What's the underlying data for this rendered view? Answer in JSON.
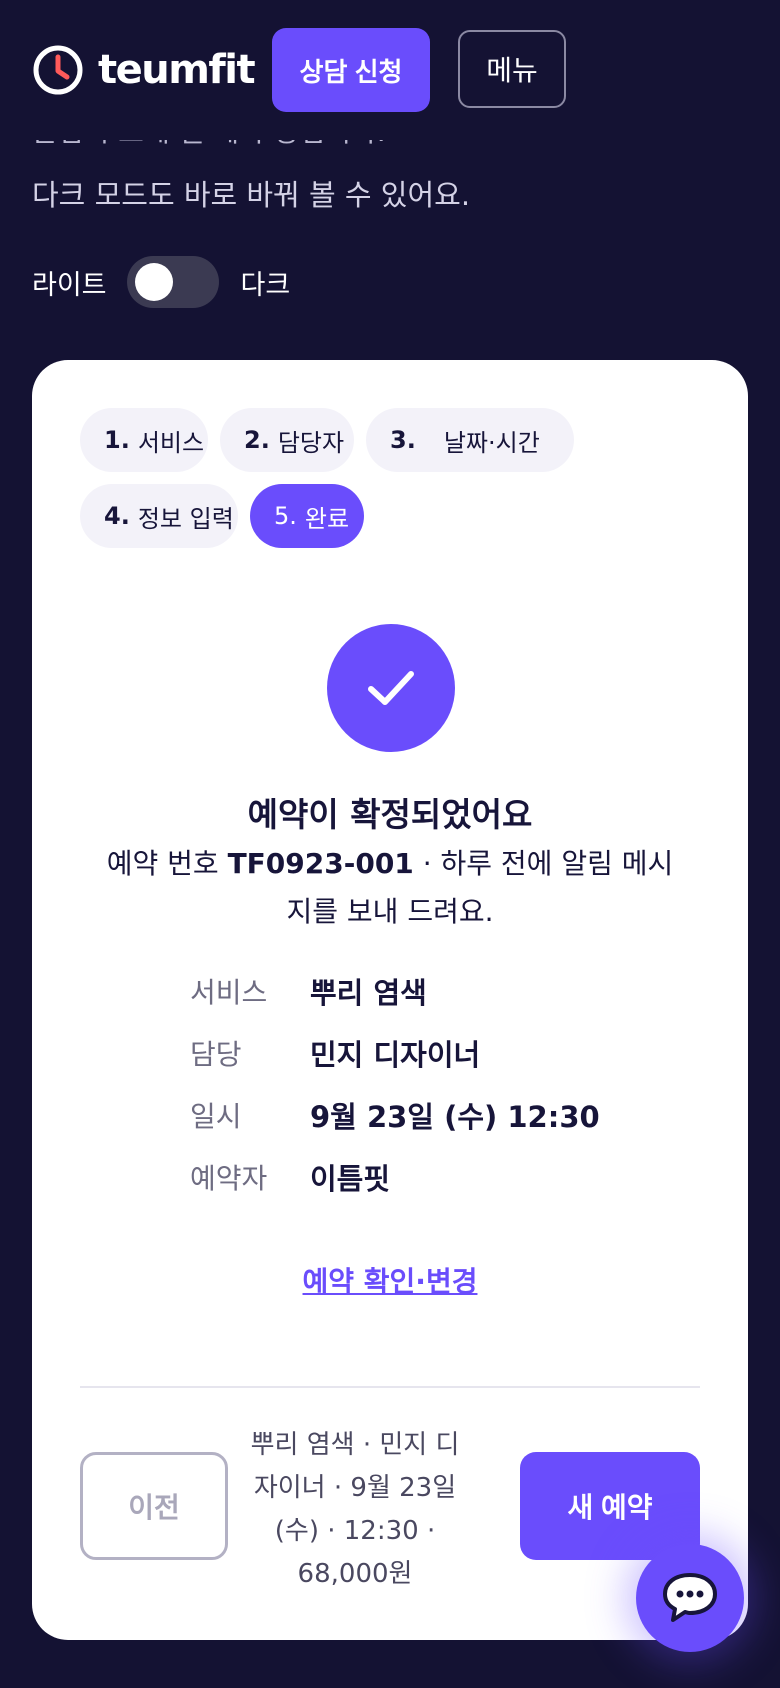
{
  "header": {
    "brand": "teumfit",
    "consult_button": "상담 신청",
    "menu_button": "메뉴"
  },
  "intro": {
    "clipped_line": "손님이 보게 될 예약 장입니다.",
    "line2": "다크 모드도 바로 바꿔 볼 수 있어요."
  },
  "theme": {
    "light_label": "라이트",
    "dark_label": "다크",
    "dark_mode_on": false
  },
  "steps": [
    {
      "num": "1.",
      "label": "서비스"
    },
    {
      "num": "2.",
      "label": "담당자"
    },
    {
      "num": "3.",
      "label": "날짜·시간"
    },
    {
      "num": "4.",
      "label": "정보 입력"
    },
    {
      "num": "5.",
      "label": "완료",
      "active": true
    }
  ],
  "confirmation": {
    "title": "예약이 확정되었어요",
    "desc_prefix": "예약 번호 ",
    "booking_no": "TF0923-001",
    "desc_suffix": " · 하루 전에 알림 메시지를 보내 드려요."
  },
  "details": [
    {
      "key": "서비스",
      "value": "뿌리 염색"
    },
    {
      "key": "담당",
      "value": "민지 디자이너"
    },
    {
      "key": "일시",
      "value": "9월 23일 (수) 12:30"
    },
    {
      "key": "예약자",
      "value": "이틈핏"
    }
  ],
  "manage_link": "예약 확인·변경",
  "footer": {
    "prev_button": "이전",
    "summary": "뿌리 염색 · 민지 디자이너 · 9월 23일 (수) · 12:30 · 68,000원",
    "new_button": "새 예약"
  },
  "colors": {
    "background": "#141233",
    "accent": "#6a4dfc",
    "card": "#ffffff"
  },
  "icons": {
    "logo": "clock-icon",
    "done": "check-icon",
    "chat": "chat-bubble-icon"
  }
}
